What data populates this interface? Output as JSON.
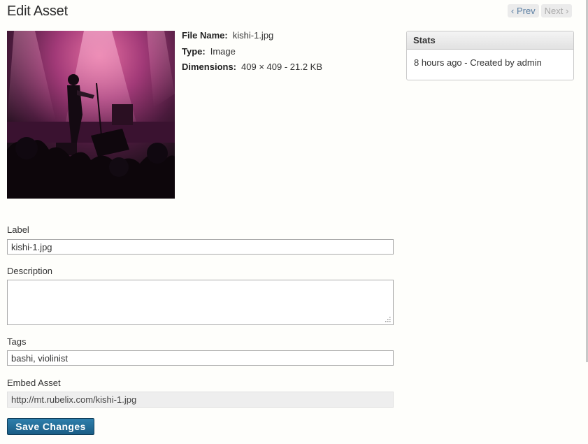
{
  "header": {
    "title": "Edit Asset",
    "prev_label": "‹ Prev",
    "next_label": "Next ›"
  },
  "asset": {
    "image_icon": "concert-photo",
    "meta": [
      {
        "key": "File Name:",
        "value": "kishi-1.jpg"
      },
      {
        "key": "Type:",
        "value": "Image"
      },
      {
        "key": "Dimensions:",
        "value": "409 × 409 - 21.2 KB"
      }
    ]
  },
  "stats": {
    "title": "Stats",
    "text": "8 hours ago - Created by admin"
  },
  "form": {
    "label": {
      "label": "Label",
      "value": "kishi-1.jpg"
    },
    "description": {
      "label": "Description",
      "value": ""
    },
    "tags": {
      "label": "Tags",
      "value": "bashi, violinist"
    },
    "embed": {
      "label": "Embed Asset",
      "value": "http://mt.rubelix.com/kishi-1.jpg"
    },
    "save_label": "Save Changes"
  },
  "colors": {
    "primary_button": "#1f6792",
    "link": "#5b7fa3",
    "background": "#fefefb"
  }
}
